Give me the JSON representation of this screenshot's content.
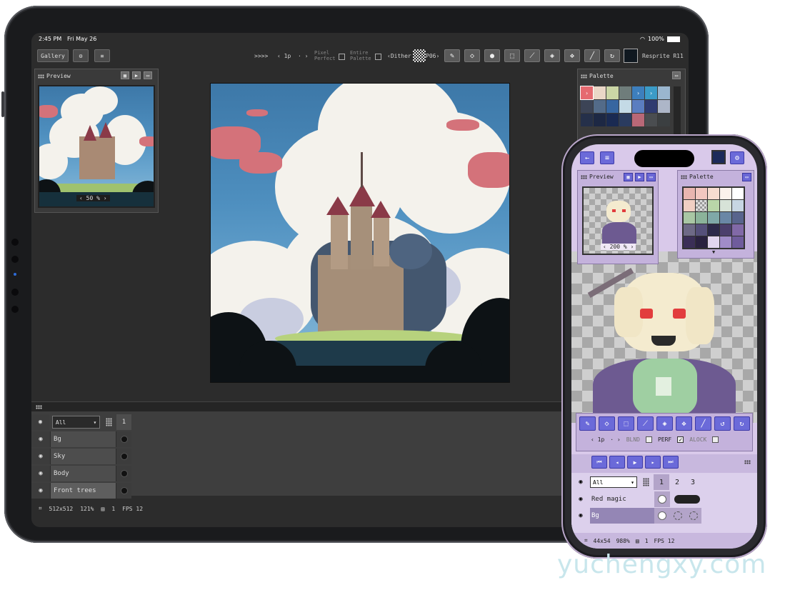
{
  "tablet": {
    "status": {
      "time": "2:45 PM",
      "date": "Fri May 26",
      "battery": "100%"
    },
    "toolbar": {
      "gallery_label": "Gallery",
      "settings_icon": "gear-icon",
      "sliders_icon": "sliders-icon",
      "shortcut_label": ">>>>",
      "brush_size": "‹ 1p",
      "brush_dots": "· ›",
      "pixel_perfect": "Pixel Perfect",
      "entire_palette": "Entire Palette",
      "dither": "‹Dither",
      "dither_pattern": "P06›",
      "tools": [
        "pencil-icon",
        "eraser-icon",
        "fill-circle-icon",
        "selection-icon",
        "eyedropper-icon",
        "bucket-icon",
        "move-icon",
        "line-icon",
        "redo-icon"
      ],
      "app_name": "Resprite R11",
      "current_color": "#101820"
    },
    "preview": {
      "title": "Preview",
      "zoom": "‹ 50 % ›"
    },
    "palette": {
      "title": "Palette",
      "colors": [
        "#e56a70",
        "#ead7c7",
        "#cbd6a6",
        "#6f7d7b",
        "#3d7fbd",
        "#3b9bc7",
        "#9ab6cf",
        "#3c4456",
        "#536b89",
        "#3766a0",
        "#c4dae6",
        "#5b7ec0",
        "#2f3b70",
        "#adb6c8",
        "#25304a",
        "#1d2844",
        "#1a2a52",
        "#2a3b5f",
        "#b96877",
        "#4a4d50",
        "#3b3f41"
      ]
    },
    "layers": {
      "filter": "All",
      "frame": "1",
      "items": [
        {
          "name": "Bg"
        },
        {
          "name": "Sky"
        },
        {
          "name": "Body"
        },
        {
          "name": "Front trees"
        }
      ]
    },
    "footer": {
      "size": "512x512",
      "zoom": "121%",
      "frames": "1",
      "fps": "FPS 12"
    }
  },
  "phone": {
    "top": {
      "back_icon": "arrow-left-icon",
      "settings_icon": "sliders-icon",
      "color": "#1c2a5a",
      "gear_icon": "gear-icon"
    },
    "preview": {
      "title": "Preview",
      "zoom": "‹ 200 % ›"
    },
    "palette": {
      "title": "Palette",
      "colors": [
        "#e9b6b0",
        "#f2c7c0",
        "#f6dcd0",
        "#fbf2ec",
        "#ffffff",
        "#f0cfc3",
        "#d8d8d8",
        "#b9d6a8",
        "#d7e3d8",
        "#c7d6e3",
        "#a9c7a4",
        "#8bb39a",
        "#7fa8a8",
        "#6a87a6",
        "#58648d",
        "#6e6a86",
        "#55507a",
        "#2d2a4a",
        "#4b3f6c",
        "#8169a7",
        "#3b2f57",
        "#2a2240",
        "#e2d6ef",
        "#a08cc8",
        "#6f5c9c"
      ]
    },
    "tools": [
      "pencil-icon",
      "eraser-icon",
      "selection-icon",
      "eyedropper-icon",
      "bucket-icon",
      "move-icon",
      "line-icon",
      "undo-icon",
      "redo-icon"
    ],
    "options": {
      "size": "‹ 1p",
      "dots": "· ›",
      "blend": "BLND",
      "perf": "PERF",
      "alock": "ALOCK"
    },
    "playback": [
      "first-frame-icon",
      "prev-frame-icon",
      "play-icon",
      "next-frame-icon",
      "last-frame-icon"
    ],
    "layers": {
      "filter": "All",
      "frames": [
        "1",
        "2",
        "3"
      ],
      "items": [
        {
          "name": "Red magic"
        },
        {
          "name": "Bg"
        }
      ]
    },
    "footer": {
      "size": "44x54",
      "zoom": "988%",
      "frames": "1",
      "fps": "FPS 12"
    }
  },
  "watermark": "yuchengxy.com"
}
